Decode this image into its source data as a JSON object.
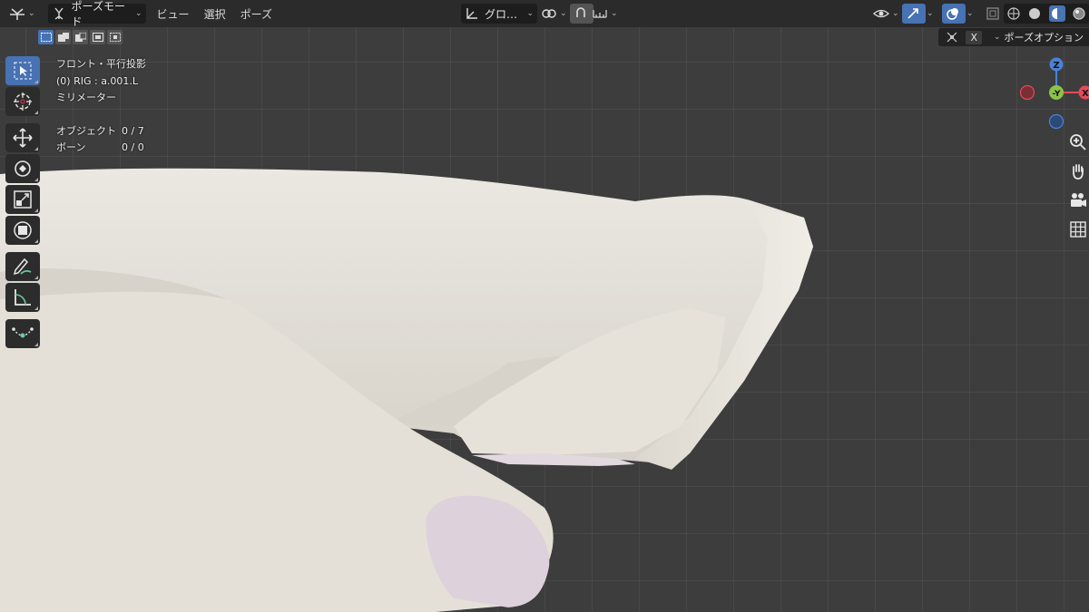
{
  "header": {
    "mode_label": "ポーズモード",
    "menus": [
      "ビュー",
      "選択",
      "ポーズ"
    ],
    "orientation_label": "グロ…",
    "icons": [
      "editor-type-icon",
      "pose-mode-icon",
      "transform-orientation-icon",
      "pivot-icon",
      "snap-icon",
      "proportional-icon",
      "visibility-icon",
      "gizmo-icon",
      "overlay-icon",
      "xray-icon",
      "wireframe-shading-icon",
      "solid-shading-icon",
      "material-shading-icon",
      "rendered-shading-icon"
    ]
  },
  "pose_options": {
    "x_label": "X",
    "label": "ポーズオプション"
  },
  "info": {
    "view": "フロント・平行投影",
    "object": "(0) RIG : a.001.L",
    "unit": "ミリメーター",
    "objects_label": "オブジェクト",
    "objects_value": "0 / 7",
    "bones_label": "ボーン",
    "bones_value": "0 / 0"
  },
  "tools": [
    "select-box-icon",
    "cursor-icon",
    "move-icon",
    "rotate-icon",
    "scale-icon",
    "transform-icon",
    "annotate-icon",
    "measure-icon",
    "pose-relax-icon"
  ],
  "gizmo": {
    "z": "Z",
    "y": "-Y",
    "x": "X",
    "colors": {
      "x": "#e34b5a",
      "y": "#8bc34a",
      "z": "#4a82d6"
    }
  },
  "skin_color": "#e8e4dc",
  "nail_color": "#ddd2dc"
}
